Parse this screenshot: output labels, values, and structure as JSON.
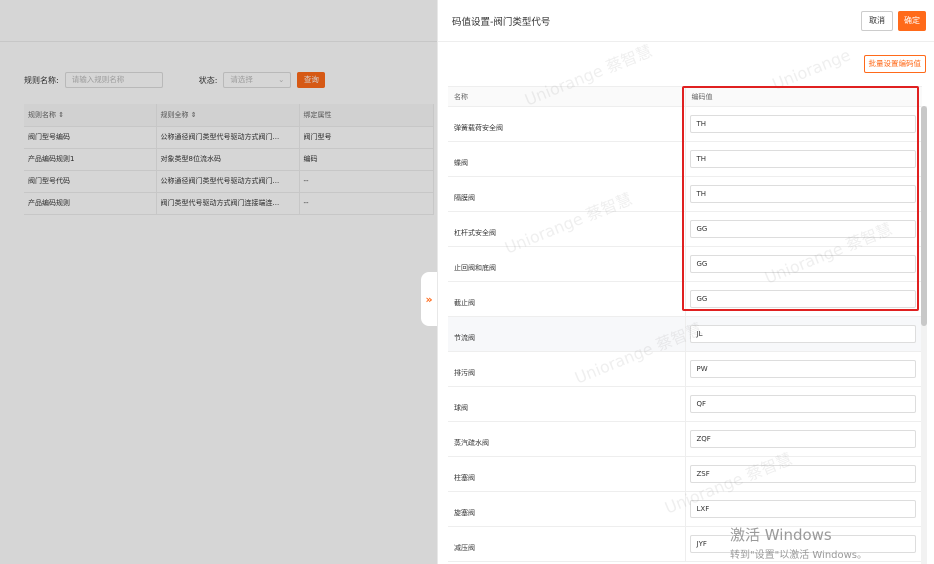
{
  "background": {
    "search": {
      "rule_name_label": "规则名称:",
      "rule_name_placeholder": "请输入规则名称",
      "status_label": "状态:",
      "status_placeholder": "请选择",
      "query_button": "查询"
    },
    "table": {
      "headers": [
        "规则名称 ⇕",
        "规则全称 ⇕",
        "绑定属性"
      ],
      "rows": [
        [
          "阀门型号编码",
          "公称通径阀门类型代号驱动方式阀门...",
          "阀门型号"
        ],
        [
          "产品编码规则1",
          "对象类型8位流水码",
          "编码"
        ],
        [
          "阀门型号代码",
          "公称通径阀门类型代号驱动方式阀门...",
          "--"
        ],
        [
          "产品编码规则",
          "阀门类型代号驱动方式阀门连接端连...",
          "--"
        ]
      ]
    }
  },
  "drawer": {
    "title": "码值设置-阀门类型代号",
    "cancel_label": "取消",
    "ok_label": "确定",
    "batch_label": "批量设置编码值",
    "table": {
      "col_name": "名称",
      "col_code": "编码值",
      "rows": [
        {
          "name": "弹簧载荷安全阀",
          "code": "TH"
        },
        {
          "name": "蝶阀",
          "code": "TH"
        },
        {
          "name": "隔膜阀",
          "code": "TH"
        },
        {
          "name": "杠杆式安全阀",
          "code": "GG"
        },
        {
          "name": "止回阀和底阀",
          "code": "GG"
        },
        {
          "name": "截止阀",
          "code": "GG"
        },
        {
          "name": "节流阀",
          "code": "JL"
        },
        {
          "name": "排污阀",
          "code": "PW"
        },
        {
          "name": "球阀",
          "code": "QF"
        },
        {
          "name": "蒸汽疏水阀",
          "code": "ZQF"
        },
        {
          "name": "柱塞阀",
          "code": "ZSF"
        },
        {
          "name": "旋塞阀",
          "code": "LXF"
        },
        {
          "name": "减压阀",
          "code": "JYF"
        }
      ]
    }
  },
  "toggle_icon": "»",
  "watermarks": [
    "Uniorange 蔡智慧",
    "Uniorange 蔡智慧",
    "Uniorange 蔡智慧",
    "Uniorange 蔡智慧",
    "Uniorange 蔡智慧",
    "Uniorange 蔡智慧",
    "Uniorange"
  ],
  "activation": {
    "line1": "激活 Windows",
    "line2": "转到\"设置\"以激活 Windows。"
  },
  "colors": {
    "accent": "#ff6a1a",
    "highlight_box": "#e02020"
  }
}
